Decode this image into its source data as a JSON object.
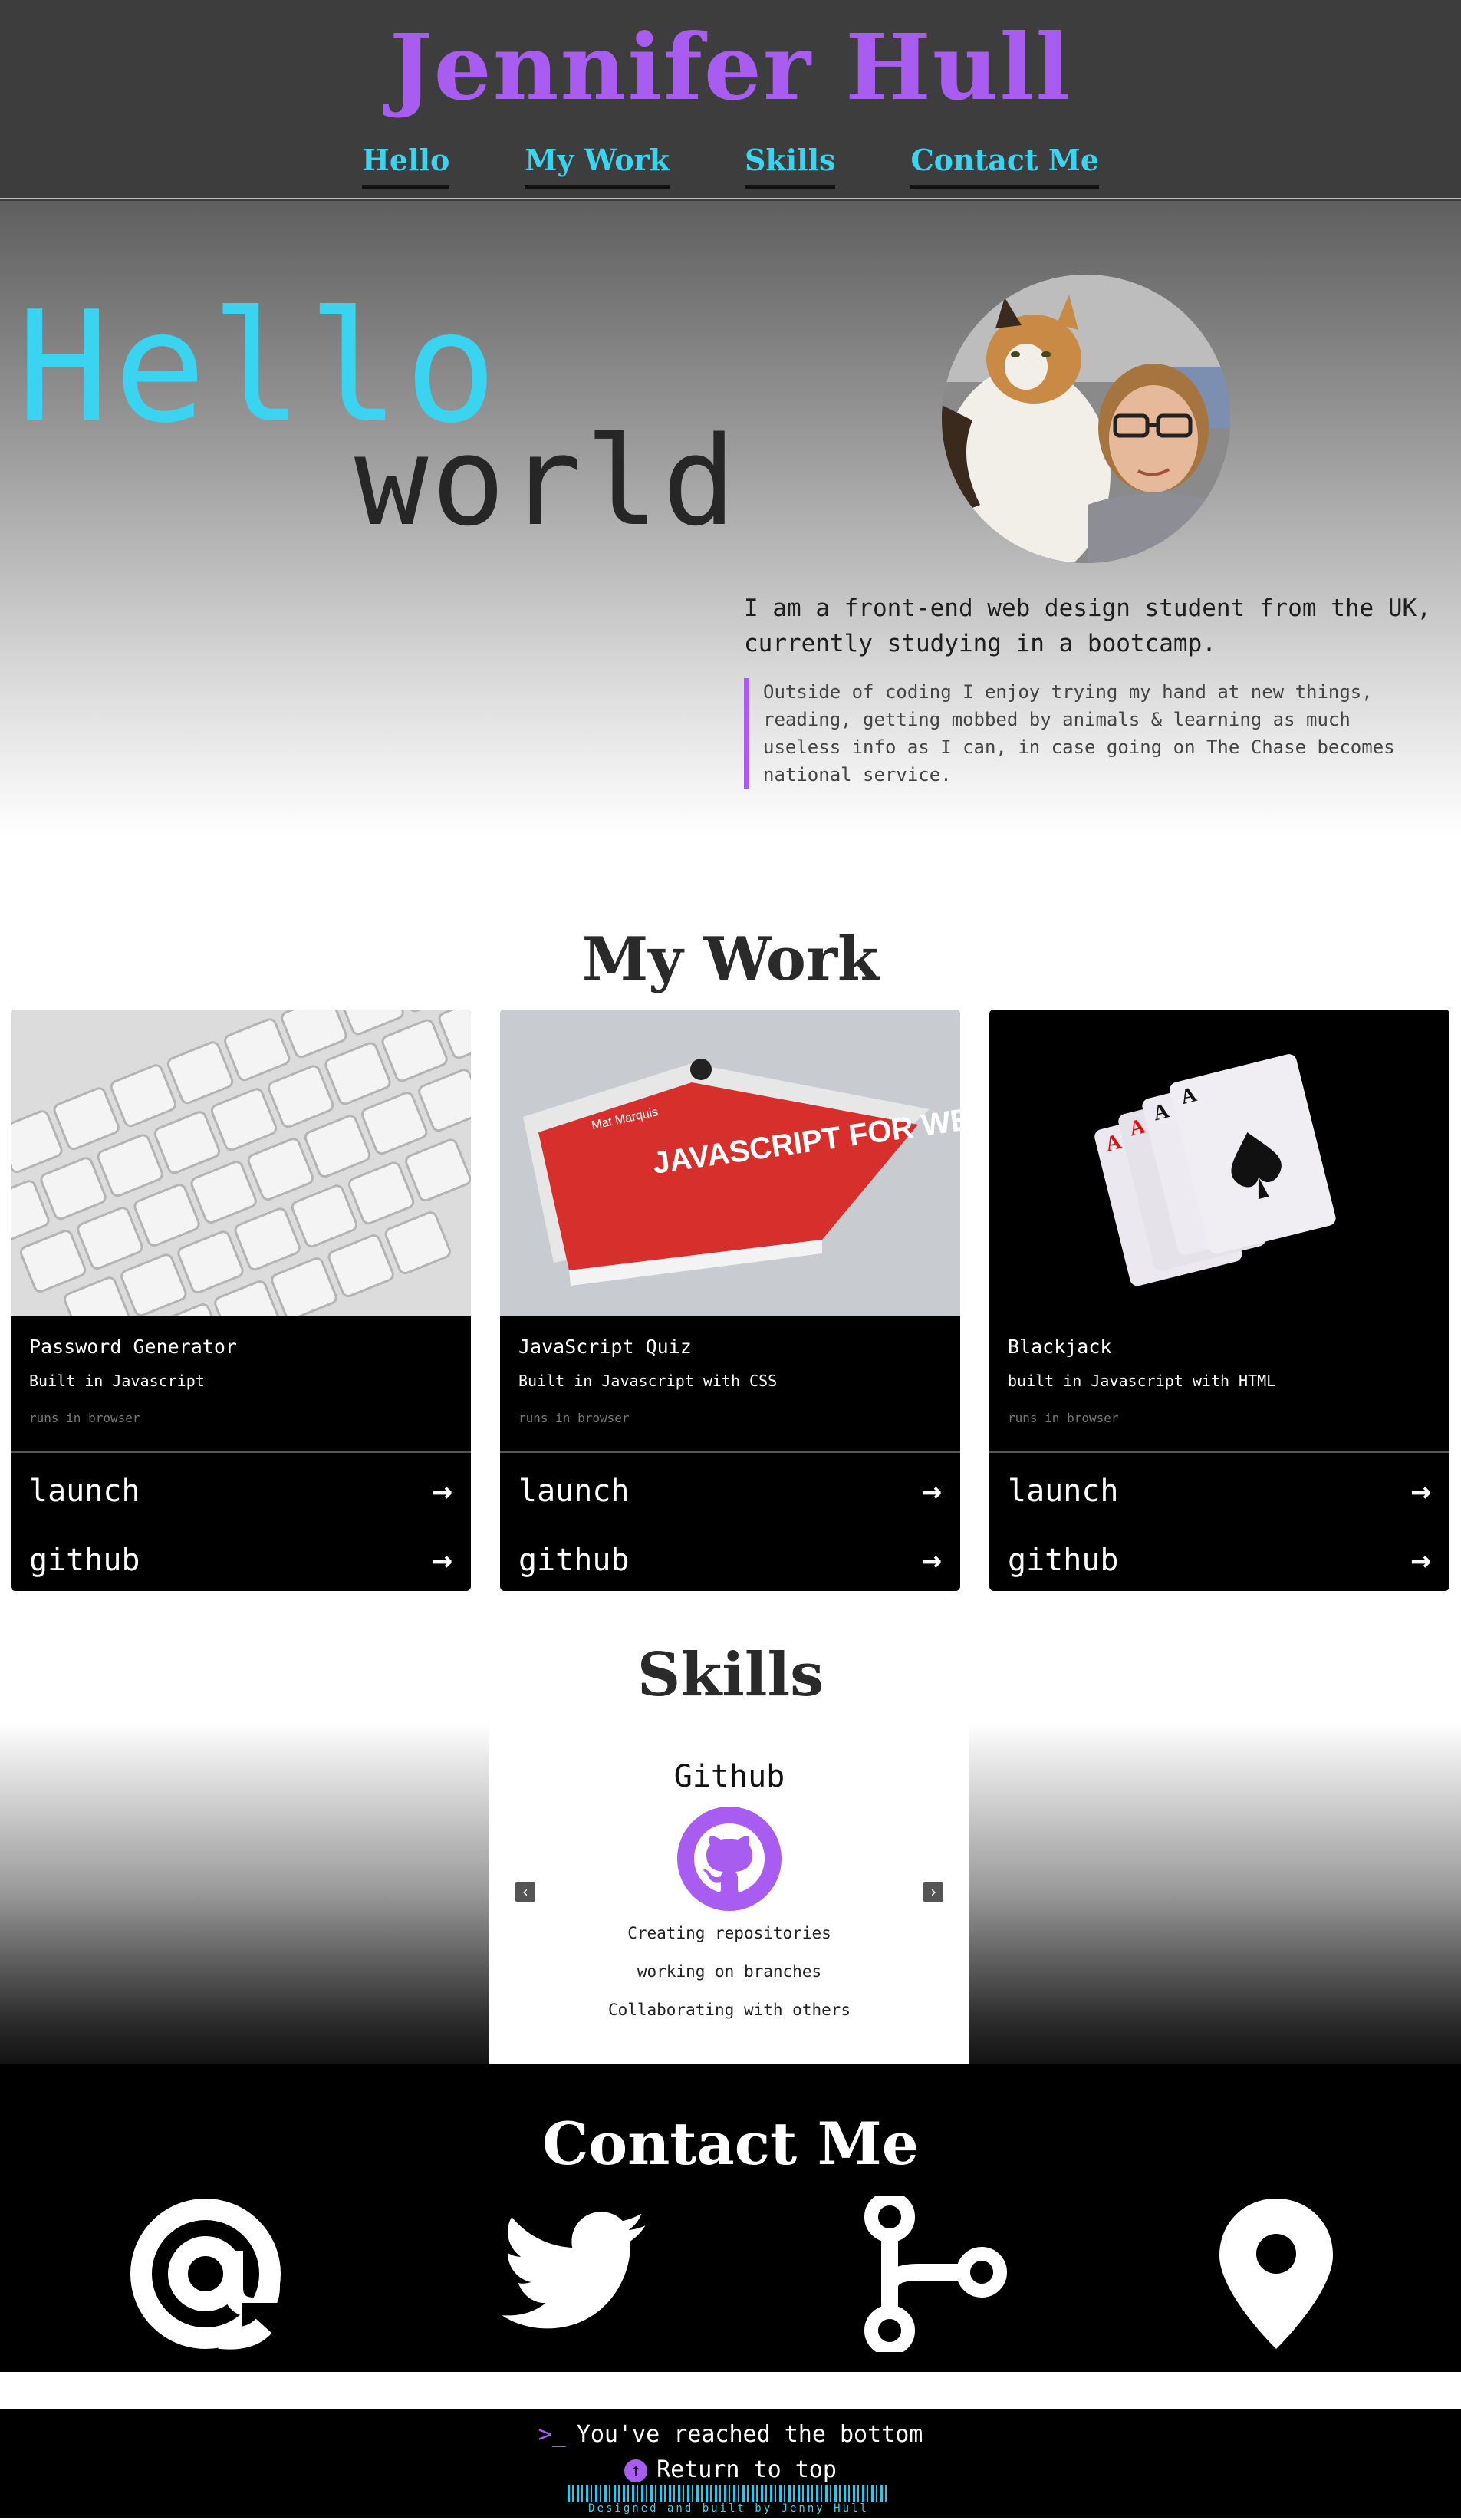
{
  "header": {
    "site_title": "Jennifer Hull",
    "nav": [
      "Hello",
      "My Work",
      "Skills",
      "Contact Me"
    ]
  },
  "hero": {
    "hello": "Hello",
    "world": "world",
    "intro": "I am a front-end web design student from the UK, currently studying in a bootcamp.",
    "quote": "Outside of coding I enjoy trying my hand at new things, reading, getting mobbed by animals & learning as much useless info as I can, in case going on The Chase becomes national service."
  },
  "work": {
    "title": "My Work",
    "projects": [
      {
        "name": "Password Generator",
        "desc": "Built in Javascript",
        "runs": "runs in browser",
        "launch": "launch",
        "github": "github"
      },
      {
        "name": "JavaScript Quiz",
        "desc": "Built in Javascript with CSS",
        "runs": "runs in browser",
        "launch": "launch",
        "github": "github",
        "book_title": "JAVASCRIPT FOR WEB DESIGNERS",
        "book_author": "Mat Marquis"
      },
      {
        "name": "Blackjack",
        "desc": "built in Javascript with HTML",
        "runs": "runs in browser",
        "launch": "launch",
        "github": "github"
      }
    ]
  },
  "skills": {
    "title": "Skills",
    "current": {
      "name": "Github",
      "icon": "github-icon",
      "items": [
        "Creating repositories",
        "working on branches",
        "Collaborating with others"
      ]
    }
  },
  "contact": {
    "title": "Contact Me",
    "icons": [
      "at-sign-icon",
      "twitter-icon",
      "git-branch-icon",
      "map-pin-icon"
    ]
  },
  "footer": {
    "bottom_text": "You've reached the bottom",
    "return_text": "Return to top",
    "credit": "Designed and built by Jenny Hull"
  },
  "colors": {
    "accent_purple": "#a95cf0",
    "accent_cyan": "#3ad3f0",
    "header_bg": "#3d3d3d"
  }
}
